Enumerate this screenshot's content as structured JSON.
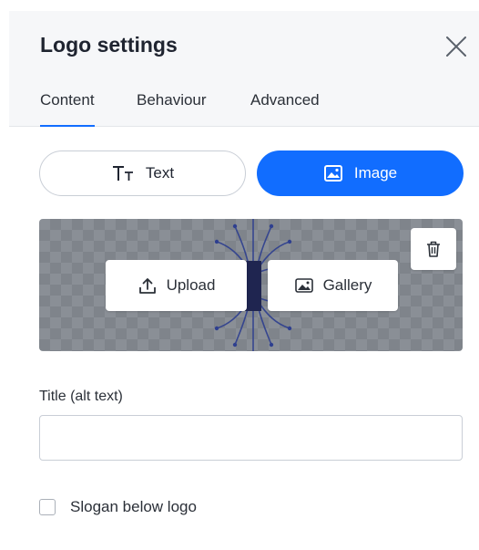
{
  "panel": {
    "title": "Logo settings",
    "close_icon": "close-icon"
  },
  "tabs": [
    {
      "label": "Content",
      "active": true
    },
    {
      "label": "Behaviour",
      "active": false
    },
    {
      "label": "Advanced",
      "active": false
    }
  ],
  "mode_toggle": {
    "text_label": "Text",
    "image_label": "Image",
    "selected": "Image",
    "accent_color": "#116dff"
  },
  "preview": {
    "upload_label": "Upload",
    "gallery_label": "Gallery"
  },
  "alt_text": {
    "label": "Title (alt text)",
    "value": "",
    "placeholder": ""
  },
  "slogan": {
    "label": "Slogan below logo",
    "checked": false
  }
}
